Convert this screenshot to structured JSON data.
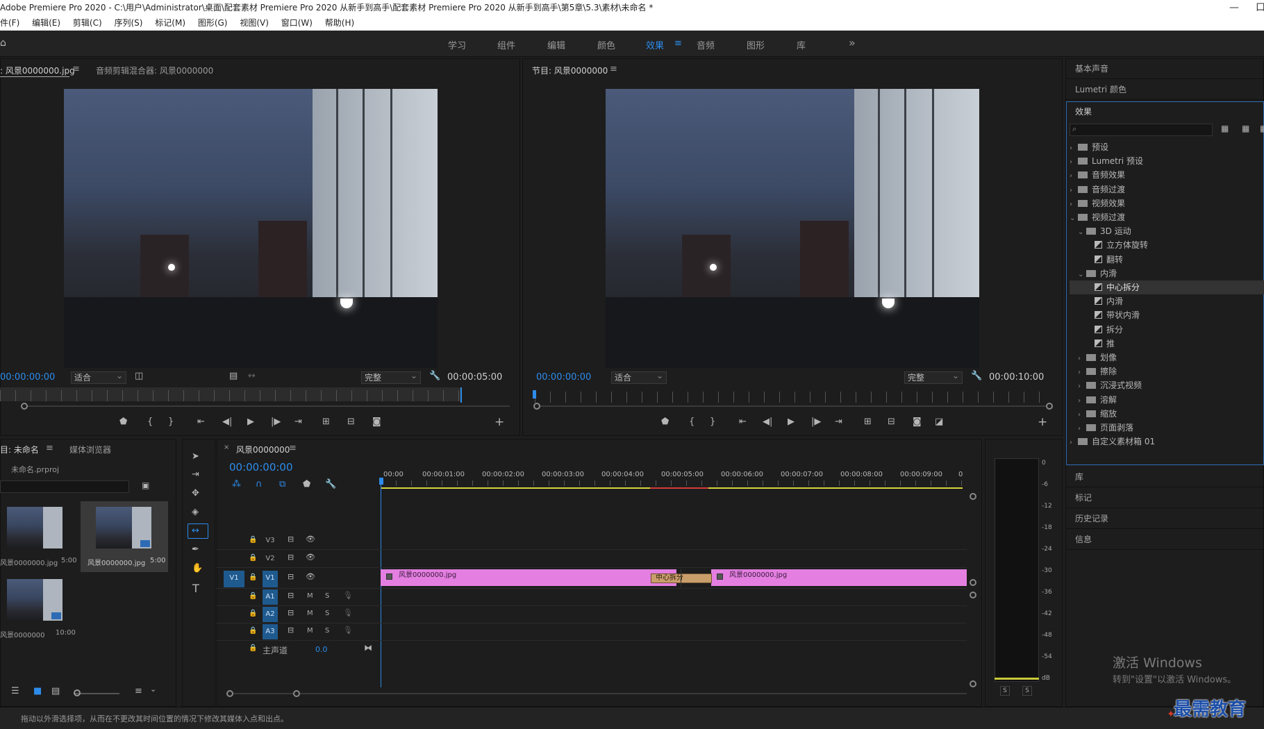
{
  "window": {
    "title": "Adobe Premiere Pro 2020 - C:\\用户\\Administrator\\桌面\\配套素材 Premiere Pro 2020 从新手到高手\\配套素材 Premiere Pro 2020 从新手到高手\\第5章\\5.3\\素材\\未命名 *",
    "minimize": "—",
    "maximize": "口"
  },
  "menu": [
    "件(F)",
    "编辑(E)",
    "剪辑(C)",
    "序列(S)",
    "标记(M)",
    "图形(G)",
    "视图(V)",
    "窗口(W)",
    "帮助(H)"
  ],
  "workspaces": [
    "学习",
    "组件",
    "编辑",
    "颜色",
    "效果",
    "音频",
    "图形",
    "库"
  ],
  "workspace_active": "效果",
  "workspace_menu_glyph": "≡",
  "workspace_more": "»",
  "source": {
    "tab1": ": 风景0000000.jpg",
    "tab1_menu": "≡",
    "tab2": "音频剪辑混合器: 风景0000000",
    "timecode_in": "00:00:00:00",
    "fit": "适合",
    "quality": "完整",
    "duration": "00:00:05:00"
  },
  "program": {
    "tab": "节目: 风景0000000",
    "tab_menu": "≡",
    "timecode_in": "00:00:00:00",
    "fit": "适合",
    "quality": "完整",
    "duration": "00:00:10:00"
  },
  "project": {
    "tab1": "目: 未命名",
    "tab1_menu": "≡",
    "tab2": "媒体浏览器",
    "file": "未命名.prproj",
    "items": [
      {
        "name": "风景0000000.jpg",
        "dur": "5:00"
      },
      {
        "name": "风景0000000.jpg",
        "dur": "5:00"
      },
      {
        "name": "风景0000000",
        "dur": "10:00"
      }
    ]
  },
  "timeline": {
    "close": "×",
    "tab": "风景0000000",
    "tab_menu": "≡",
    "timecode": "00:00:00:00",
    "ruler": [
      "00:00",
      "00:00:01:00",
      "00:00:02:00",
      "00:00:03:00",
      "00:00:04:00",
      "00:00:05:00",
      "00:00:06:00",
      "00:00:07:00",
      "00:00:08:00",
      "00:00:09:00",
      "0"
    ],
    "tracks": [
      {
        "src": "",
        "name": "V3",
        "toggles": [
          "",
          ""
        ]
      },
      {
        "src": "",
        "name": "V2",
        "toggles": [
          "",
          ""
        ]
      },
      {
        "src": "V1",
        "name": "V1",
        "toggles": [
          "",
          ""
        ]
      },
      {
        "src": "",
        "name": "A1",
        "toggles": [
          "M",
          "S"
        ]
      },
      {
        "src": "",
        "name": "A2",
        "toggles": [
          "M",
          "S"
        ]
      },
      {
        "src": "",
        "name": "A3",
        "toggles": [
          "M",
          "S"
        ]
      }
    ],
    "master_label": "主声道",
    "master_value": "0.0",
    "clip1": "风景0000000.jpg",
    "clip2": "风景0000000.jpg",
    "transition": "中心拆分"
  },
  "meter": {
    "scale": [
      "0",
      "-6",
      "-12",
      "-18",
      "-24",
      "-30",
      "-36",
      "-42",
      "-48",
      "-54",
      "dB"
    ],
    "solo1": "S",
    "solo2": "S"
  },
  "right_panels": {
    "basic_sound": "基本声音",
    "lumetri": "Lumetri 颜色",
    "effects_title": "效果",
    "tree": [
      {
        "label": "预设",
        "level": 0,
        "kind": "folder",
        "open": false
      },
      {
        "label": "Lumetri 预设",
        "level": 0,
        "kind": "folder",
        "open": false
      },
      {
        "label": "音频效果",
        "level": 0,
        "kind": "folder",
        "open": false
      },
      {
        "label": "音频过渡",
        "level": 0,
        "kind": "folder",
        "open": false
      },
      {
        "label": "视频效果",
        "level": 0,
        "kind": "folder",
        "open": false
      },
      {
        "label": "视频过渡",
        "level": 0,
        "kind": "folder",
        "open": true
      },
      {
        "label": "3D 运动",
        "level": 1,
        "kind": "folder",
        "open": true
      },
      {
        "label": "立方体旋转",
        "level": 2,
        "kind": "fx"
      },
      {
        "label": "翻转",
        "level": 2,
        "kind": "fx"
      },
      {
        "label": "内滑",
        "level": 1,
        "kind": "folder",
        "open": true
      },
      {
        "label": "中心拆分",
        "level": 2,
        "kind": "fx",
        "selected": true
      },
      {
        "label": "内滑",
        "level": 2,
        "kind": "fx"
      },
      {
        "label": "带状内滑",
        "level": 2,
        "kind": "fx"
      },
      {
        "label": "拆分",
        "level": 2,
        "kind": "fx"
      },
      {
        "label": "推",
        "level": 2,
        "kind": "fx"
      },
      {
        "label": "划像",
        "level": 1,
        "kind": "folder",
        "open": false
      },
      {
        "label": "擦除",
        "level": 1,
        "kind": "folder",
        "open": false
      },
      {
        "label": "沉浸式视频",
        "level": 1,
        "kind": "folder",
        "open": false
      },
      {
        "label": "溶解",
        "level": 1,
        "kind": "folder",
        "open": false
      },
      {
        "label": "缩放",
        "level": 1,
        "kind": "folder",
        "open": false
      },
      {
        "label": "页面剥落",
        "level": 1,
        "kind": "folder",
        "open": false
      },
      {
        "label": "自定义素材箱 01",
        "level": 0,
        "kind": "folder",
        "open": false
      }
    ],
    "library": "库",
    "markers": "标记",
    "history": "历史记录",
    "info": "信息"
  },
  "status": "拖动以外滑选择项，从而在不更改其时间位置的情况下修改其媒体入点和出点。",
  "activation": {
    "line1": "激活 Windows",
    "line2": "转到\"设置\"以激活 Windows。"
  },
  "watermark": "最需教育",
  "colors": {
    "accent": "#2d8ceb",
    "clip": "#e47fe1",
    "track_on": "#1f5a8f",
    "panel": "#1d1d1d"
  }
}
